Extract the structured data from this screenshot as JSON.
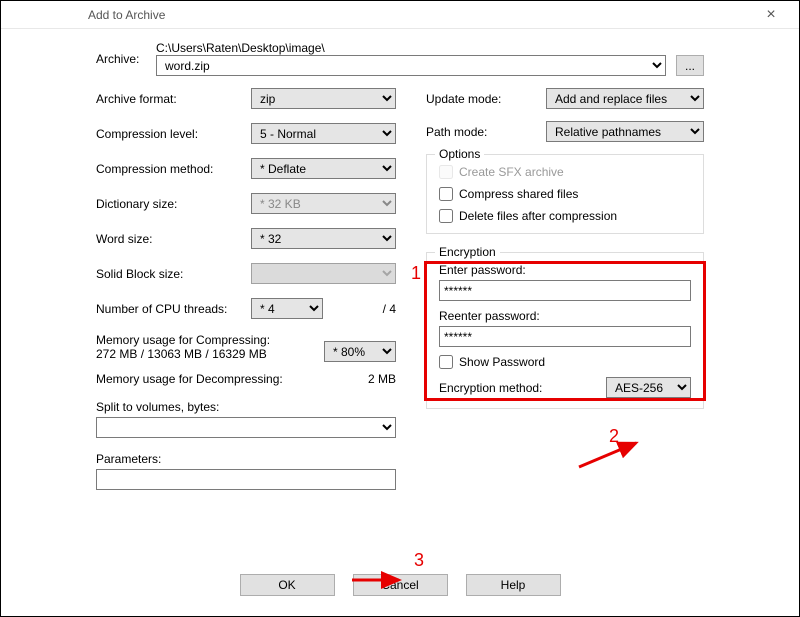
{
  "window": {
    "title": "Add to Archive",
    "close": "×"
  },
  "archive": {
    "label": "Archive:",
    "path": "C:\\Users\\Raten\\Desktop\\image\\",
    "filename": "word.zip",
    "browse": "..."
  },
  "left": {
    "format_label": "Archive format:",
    "format_value": "zip",
    "level_label": "Compression level:",
    "level_value": "5 - Normal",
    "method_label": "Compression method:",
    "method_value": "* Deflate",
    "dict_label": "Dictionary size:",
    "dict_value": "* 32 KB",
    "word_label": "Word size:",
    "word_value": "* 32",
    "solid_label": "Solid Block size:",
    "solid_value": "",
    "threads_label": "Number of CPU threads:",
    "threads_value": "* 4",
    "threads_total": "/ 4",
    "mem_comp_label": "Memory usage for Compressing:",
    "mem_comp_value": "272 MB / 13063 MB / 16329 MB",
    "mem_pct": "* 80%",
    "mem_decomp_label": "Memory usage for Decompressing:",
    "mem_decomp_value": "2 MB",
    "split_label": "Split to volumes, bytes:",
    "params_label": "Parameters:"
  },
  "right": {
    "update_label": "Update mode:",
    "update_value": "Add and replace files",
    "path_label": "Path mode:",
    "path_value": "Relative pathnames",
    "options_label": "Options",
    "sfx_label": "Create SFX archive",
    "shared_label": "Compress shared files",
    "delete_label": "Delete files after compression",
    "enc_label": "Encryption",
    "enter_pw_label": "Enter password:",
    "enter_pw_value": "******",
    "reenter_pw_label": "Reenter password:",
    "reenter_pw_value": "******",
    "show_pw_label": "Show Password",
    "enc_method_label": "Encryption method:",
    "enc_method_value": "AES-256"
  },
  "buttons": {
    "ok": "OK",
    "cancel": "Cancel",
    "help": "Help"
  },
  "annotations": {
    "n1": "1",
    "n2": "2",
    "n3": "3"
  }
}
